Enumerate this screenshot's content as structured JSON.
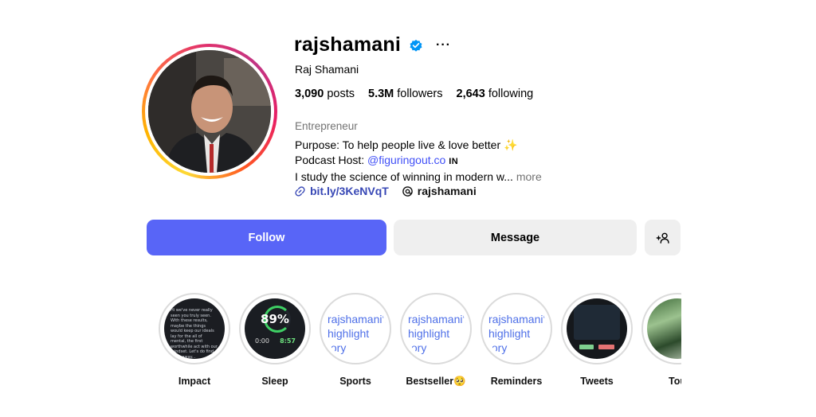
{
  "profile": {
    "username": "rajshamani",
    "full_name": "Raj Shamani",
    "verified": true,
    "stats": {
      "posts": {
        "value": "3,090",
        "label": "posts"
      },
      "followers": {
        "value": "5.3M",
        "label": "followers"
      },
      "following": {
        "value": "2,643",
        "label": "following"
      }
    },
    "category": "Entrepreneur",
    "bio": {
      "line1": "Purpose: To help people live & love better",
      "line1_emoji": "✨",
      "line2_prefix": "Podcast Host: ",
      "line2_mention": "@figuringout.co",
      "line2_suffix": "IN",
      "line3": "I study the science of winning in modern w...",
      "more": "more"
    },
    "link": "bit.ly/3KeNVqT",
    "threads_handle": "rajshamani"
  },
  "actions": {
    "follow": "Follow",
    "message": "Message",
    "suggest_icon": "add-person-icon"
  },
  "highlights": [
    {
      "label": "Impact",
      "cover": "dark-text"
    },
    {
      "label": "Sleep",
      "cover": "sleep-stats",
      "percent": "89%",
      "time_start": "0:00",
      "time_end": "8:57"
    },
    {
      "label": "Sports",
      "cover": "placeholder",
      "placeholder_lines": [
        "rajshamani'.",
        "highlight",
        "tory"
      ]
    },
    {
      "label": "Bestseller🥺",
      "cover": "placeholder",
      "placeholder_lines": [
        "rajshamani'.",
        "highlight",
        "tory"
      ]
    },
    {
      "label": "Reminders",
      "cover": "placeholder",
      "placeholder_lines": [
        "rajshamani'.",
        "highlight",
        "tory"
      ]
    },
    {
      "label": "Tweets",
      "cover": "tweets"
    },
    {
      "label": "Tou",
      "cover": "photo"
    }
  ],
  "colors": {
    "follow_button": "#5865f7",
    "secondary_button": "#efefef",
    "verified_badge": "#0095f6",
    "link": "#3747b5",
    "muted_text": "#737373"
  }
}
